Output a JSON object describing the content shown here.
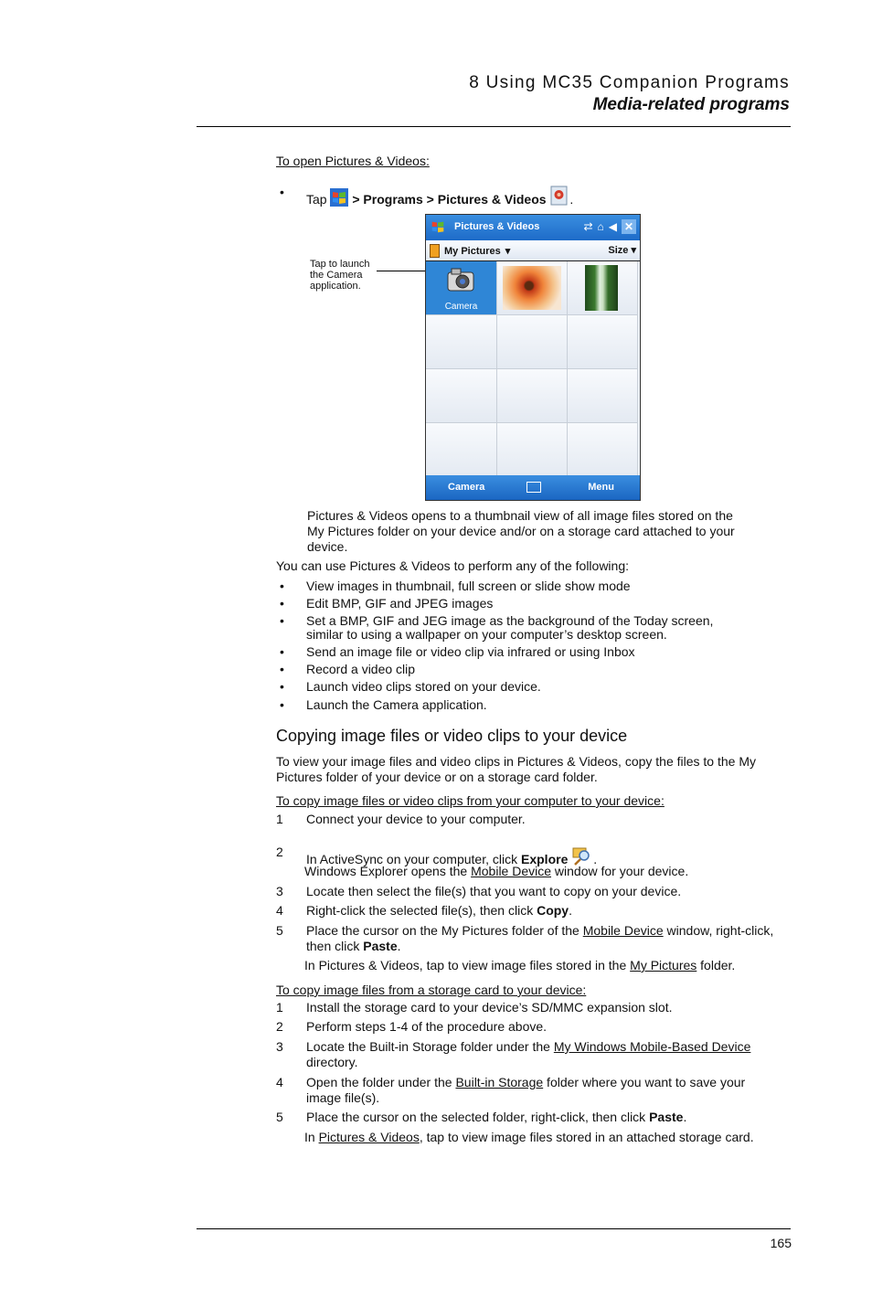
{
  "header": {
    "chapter": "8 Using MC35 Companion Programs",
    "section": "Media-related programs"
  },
  "open_pv": {
    "heading": "To open Pictures & Videos:",
    "tap": "Tap",
    "path_bold": "> Programs > Pictures & Videos",
    "period": "."
  },
  "device": {
    "title": "Pictures & Videos",
    "folder": "My Pictures",
    "sort": "Size",
    "camera_label": "Camera",
    "softkey_left": "Camera",
    "softkey_right": "Menu",
    "callout": [
      "Tap to launch",
      "the Camera",
      "application."
    ],
    "icons": [
      "windows-start-icon",
      "connectivity-icon",
      "no-signal-icon",
      "volume-icon",
      "close-icon"
    ]
  },
  "intro": [
    "Pictures & Videos opens to a thumbnail view of all image files stored on the",
    "My Pictures folder on your device and/or on a storage card attached to your",
    "device."
  ],
  "uses_intro": "You can use Pictures & Videos to perform any of the following:",
  "uses": [
    [
      "View images in thumbnail, full screen or slide show mode"
    ],
    [
      "Edit BMP, GIF and JPEG images"
    ],
    [
      "Set a BMP, GIF and JEG image as the background of the Today screen,",
      "similar to using a wallpaper on your computer’s desktop screen."
    ],
    [
      "Send an image file or video clip via infrared or using Inbox"
    ],
    [
      "Record a video clip"
    ],
    [
      "Launch video clips stored on your device."
    ],
    [
      "Launch the Camera application."
    ]
  ],
  "copy_section": {
    "title": "Copying image files or video clips to your device",
    "para": [
      "To view your image files and video clips in Pictures & Videos, copy the files to the My",
      "Pictures folder of your device or on a storage card folder."
    ],
    "proc1_heading": "To copy image files or video clips from your computer to your device:",
    "s1": "Connect your device to your computer.",
    "s2_pre": "In ActiveSync on your computer, click ",
    "s2_bold": "Explore",
    "s2_note_pre": "Windows Explorer opens the ",
    "s2_note_link": "Mobile Device",
    "s2_note_post": " window for your device.",
    "s3": "Locate then select the file(s) that you want to copy on your device.",
    "s4_pre": "Right-click the selected file(s), then click ",
    "s4_bold": "Copy",
    "s5_pre": "Place the cursor on the My Pictures folder of the ",
    "s5_link": "Mobile Device",
    "s5_post": " window, right-click,",
    "s5_l2_pre": "then click ",
    "s5_l2_bold": "Paste",
    "s5_note_pre": "In Pictures & Videos, tap to view image files stored in the ",
    "s5_note_link": "My Pictures",
    "s5_note_post": " folder.",
    "proc2_heading": "To copy image files from a storage card to your device:",
    "p1": "Install the storage card to your device’s SD/MMC expansion slot.",
    "p2": "Perform steps 1-4 of the procedure above.",
    "p3_pre": "Locate the Built-in Storage folder under the ",
    "p3_link": "My Windows Mobile-Based Device",
    "p3_l2": "directory.",
    "p4_pre": "Open the folder under the ",
    "p4_link": "Built-in Storage",
    "p4_post": " folder where you want to save your",
    "p4_l2": "image file(s).",
    "p5_pre": "Place the cursor on the selected folder, right-click, then click ",
    "p5_bold": "Paste",
    "p5_note_pre": "In ",
    "p5_note_link": "Pictures & Videos",
    "p5_note_post": ", tap to view image files stored in an attached storage card.",
    "nums": [
      "1",
      "2",
      "3",
      "4",
      "5"
    ]
  },
  "footer": {
    "page_number": "165"
  }
}
